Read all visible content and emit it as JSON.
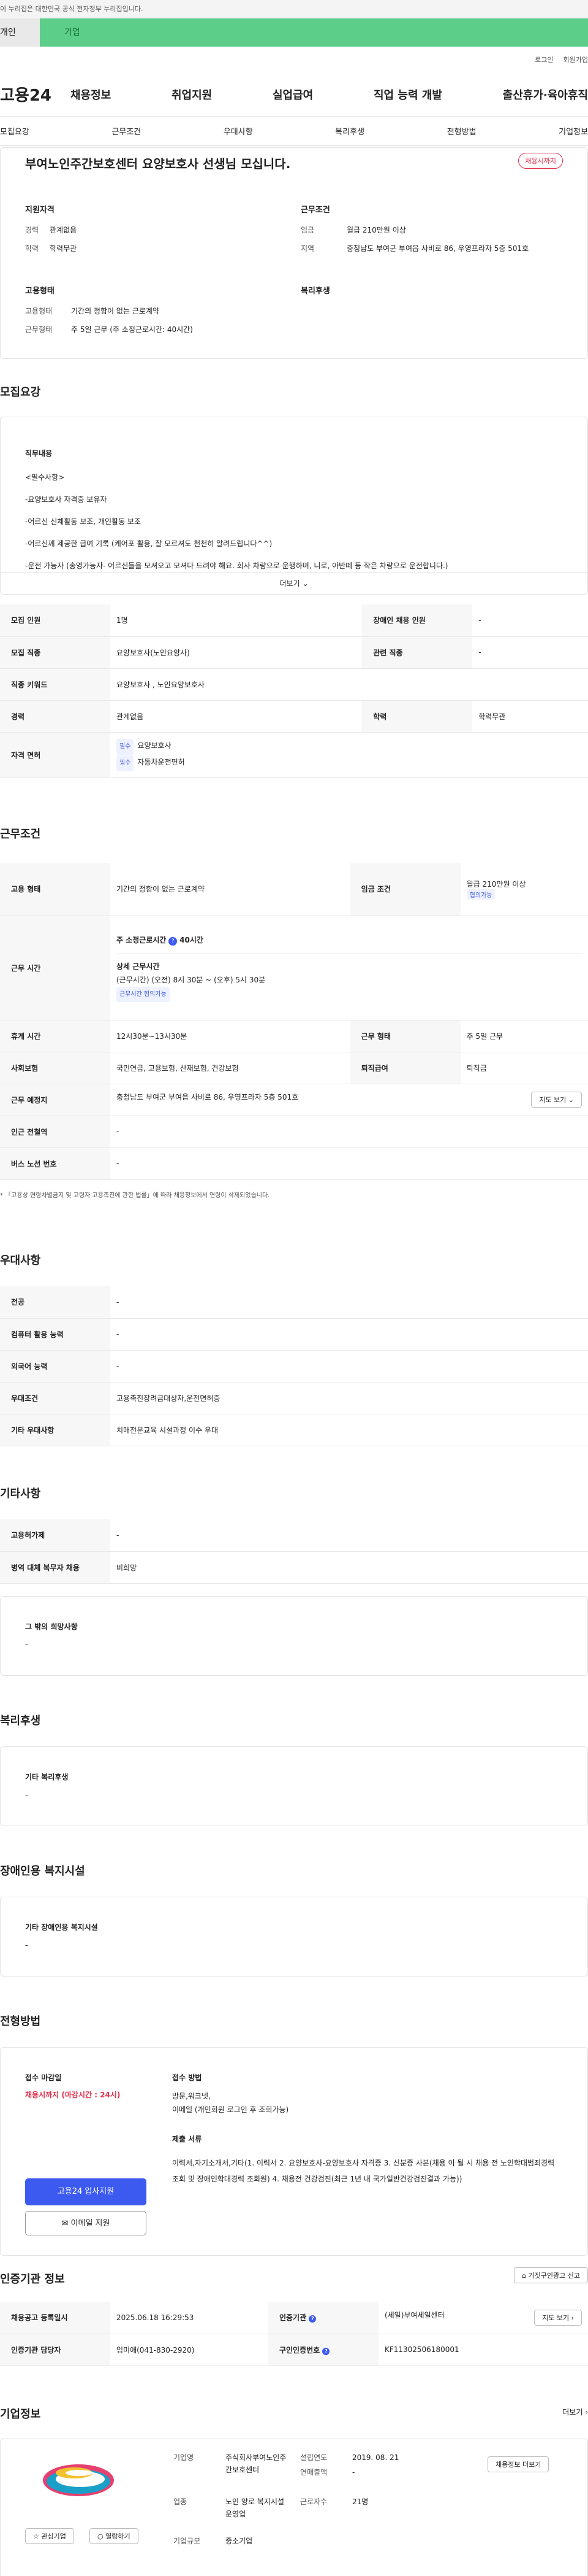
{
  "gov_banner": "이 누리집은 대한민국 공식 전자정부 누리집입니다.",
  "top_tabs": [
    "개인",
    "기업"
  ],
  "util": [
    "로그인",
    "회원가입"
  ],
  "logo": "고용24",
  "gnb": [
    "채용정보",
    "취업지원",
    "실업급여",
    "직업 능력 개발",
    "출산휴가·육아휴직"
  ],
  "subnav": [
    "모집요강",
    "근무조건",
    "우대사항",
    "복리후생",
    "전형방법",
    "기업정보"
  ],
  "job_title": "부여노인주간보호센터 요양보호사 선생님 모십니다.",
  "badge": "채용시까지",
  "summary": {
    "qual_title": "지원자격",
    "exp_k": "경력",
    "exp_v": "관계없음",
    "edu_k": "학력",
    "edu_v": "학력무관",
    "cond_title": "근무조건",
    "wage_k": "임금",
    "wage_v": "월급 210만원 이상",
    "loc_k": "지역",
    "loc_v": "충청남도 부여군 부여읍 사비로 86, 우영프라자 5층 501호",
    "emp_title": "고용형태",
    "emp_k": "고용형태",
    "emp_v": "기간의 정함이 없는 근로계약",
    "work_k": "근무형태",
    "work_v": "주 5일 근무 (주 소정근로시간: 40시간)",
    "wel_title": "복리후생"
  },
  "recruit": {
    "title": "모집요강",
    "duty_title": "직무내용",
    "lines": [
      "<필수사항>",
      "-요양보호사 자격증 보유자",
      "-어르신 신체활동 보조, 개인활동 보조",
      "-어르신께 제공한 급여 기록 (케어포 활용, 잘 모르셔도 천천히 알려드립니다^^)",
      "-운전 가능자 (송영가능자- 어르신들을 모셔오고 모셔다 드려야 해요. 회사 차량으로 운행하며, 니로, 아반떼 등 작은 차량으로 운전합니다.)"
    ],
    "more": "더보기"
  },
  "recruit_table": {
    "count_k": "모집 인원",
    "count_v": "1명",
    "disab_k": "장애인 채용 인원",
    "disab_v": "-",
    "job_k": "모집 직종",
    "job_v": "요양보호사(노인요양사)",
    "rel_k": "관련 직종",
    "rel_v": "-",
    "kw_k": "직종 키워드",
    "kw_v": "요양보호사 , 노인요양보호사",
    "exp_k": "경력",
    "exp_v": "관계없음",
    "edu_k": "학력",
    "edu_v": "학력무관",
    "lic_k": "자격 면허",
    "lic_req": "필수",
    "lic1": "요양보호사",
    "lic2": "자동차운전면허"
  },
  "cond": {
    "title": "근무조건",
    "emp_k": "고용 형태",
    "emp_v": "기간의 정함이 없는 근로계약",
    "wage_k": "임금 조건",
    "wage_v": "월급 210만원 이상",
    "wage_tag": "협의가능",
    "time_k": "근무 시간",
    "weekly": "주 소정근로시간",
    "weekly_v": "40시간",
    "detail_t": "상세 근무시간",
    "detail_v": "(근무시간) (오전) 8시 30분 ~ (오후) 5시 30분",
    "detail_tag": "근무시간 협의가능",
    "rest_k": "휴게 시간",
    "rest_v": "12시30분~13시30분",
    "form_k": "근무 형태",
    "form_v": "주 5일 근무",
    "ins_k": "사회보험",
    "ins_v": "국민연금, 고용보험, 산재보험, 건강보험",
    "ret_k": "퇴직급여",
    "ret_v": "퇴직금",
    "place_k": "근무 예정지",
    "place_v": "충청남도 부여군 부여읍 사비로 86, 우영프라자 5층 501호",
    "map": "지도 보기",
    "sub_k": "인근 전철역",
    "sub_v": "-",
    "bus_k": "버스 노선 번호",
    "bus_v": "-",
    "note": "* 「고용상 연령차별금지 및 고령자 고용촉진에 관한 법률」에 따라 채용정보에서 연령이 삭제되었습니다."
  },
  "pref": {
    "title": "우대사항",
    "major_k": "전공",
    "major_v": "-",
    "pc_k": "컴퓨터 활용 능력",
    "pc_v": "-",
    "lang_k": "외국어 능력",
    "lang_v": "-",
    "cond_k": "우대조건",
    "cond_v": "고용촉진장려금대상자,운전면허증",
    "etc_k": "기타 우대사항",
    "etc_v": "치매전문교육 시설과정 이수 우대"
  },
  "etc": {
    "title": "기타사항",
    "dev_k": "고용허가제",
    "dev_v": "-",
    "mil_k": "병역 대체 복무자 채용",
    "mil_v": "비희망",
    "other_t": "그 밖의 희망사항",
    "other_v": "-"
  },
  "welfare": {
    "title": "복리후생",
    "sub": "기타 복리후생",
    "v": "-"
  },
  "disab": {
    "title": "장애인용 복지시설",
    "sub": "기타 장애인용 복지시설",
    "v": "-"
  },
  "screen": {
    "title": "전형방법",
    "dead_t": "접수 마감일",
    "dead_v": "채용시까지 (마감시간 : 24시)",
    "apply_btn": "고용24 입사지원",
    "mail_btn": "이메일 지원",
    "method_t": "접수 방법",
    "method_v": "방문,워크넷,",
    "method_v2": "이메일 (개인회원 로그인 후 조회가능)",
    "doc_t": "제출 서류",
    "doc_v": "이력서,자기소개서,기타(1. 이력서 2. 요양보호사-요양보호사 자격증 3. 신분증 사본(채용 이 될 시 채용 전 노인학대범죄경력조회 및 장애인학대경력 조회원) 4. 채용전 건강검진(최근 1년 내 국가일반건강검진결과 가능))"
  },
  "cert": {
    "title": "인증기관 정보",
    "report": "거짓구인광고 신고",
    "reg_k": "채용공고 등록일시",
    "reg_v": "2025.06.18 16:29:53",
    "org_k": "인증기관",
    "org_v": "(세일)부여세일센터",
    "map": "지도 보기",
    "mgr_k": "인증기관 담당자",
    "mgr_v": "임미애(041-830-2920)",
    "no_k": "구인인증번호",
    "no_v": "KF11302506180001"
  },
  "company": {
    "title": "기업정보",
    "more": "더보기",
    "name_k": "기업명",
    "name_v": "주식회사부여노인주간보호센터",
    "est_k": "설립연도",
    "est_v": "2019. 08. 21",
    "sales_k": "연매출액",
    "sales_v": "-",
    "biz_k": "업종",
    "biz_v": "노인 양로 복지시설 운영업",
    "emp_k": "근로자수",
    "emp_v": "21명",
    "size_k": "기업규모",
    "size_v": "중소기업",
    "fav": "관심기업",
    "follow": "열람하기",
    "more_btn": "채용정보 더보기"
  },
  "colors": {
    "green": "#5cce8a",
    "blue": "#3d5af0",
    "red": "#e0304a"
  }
}
